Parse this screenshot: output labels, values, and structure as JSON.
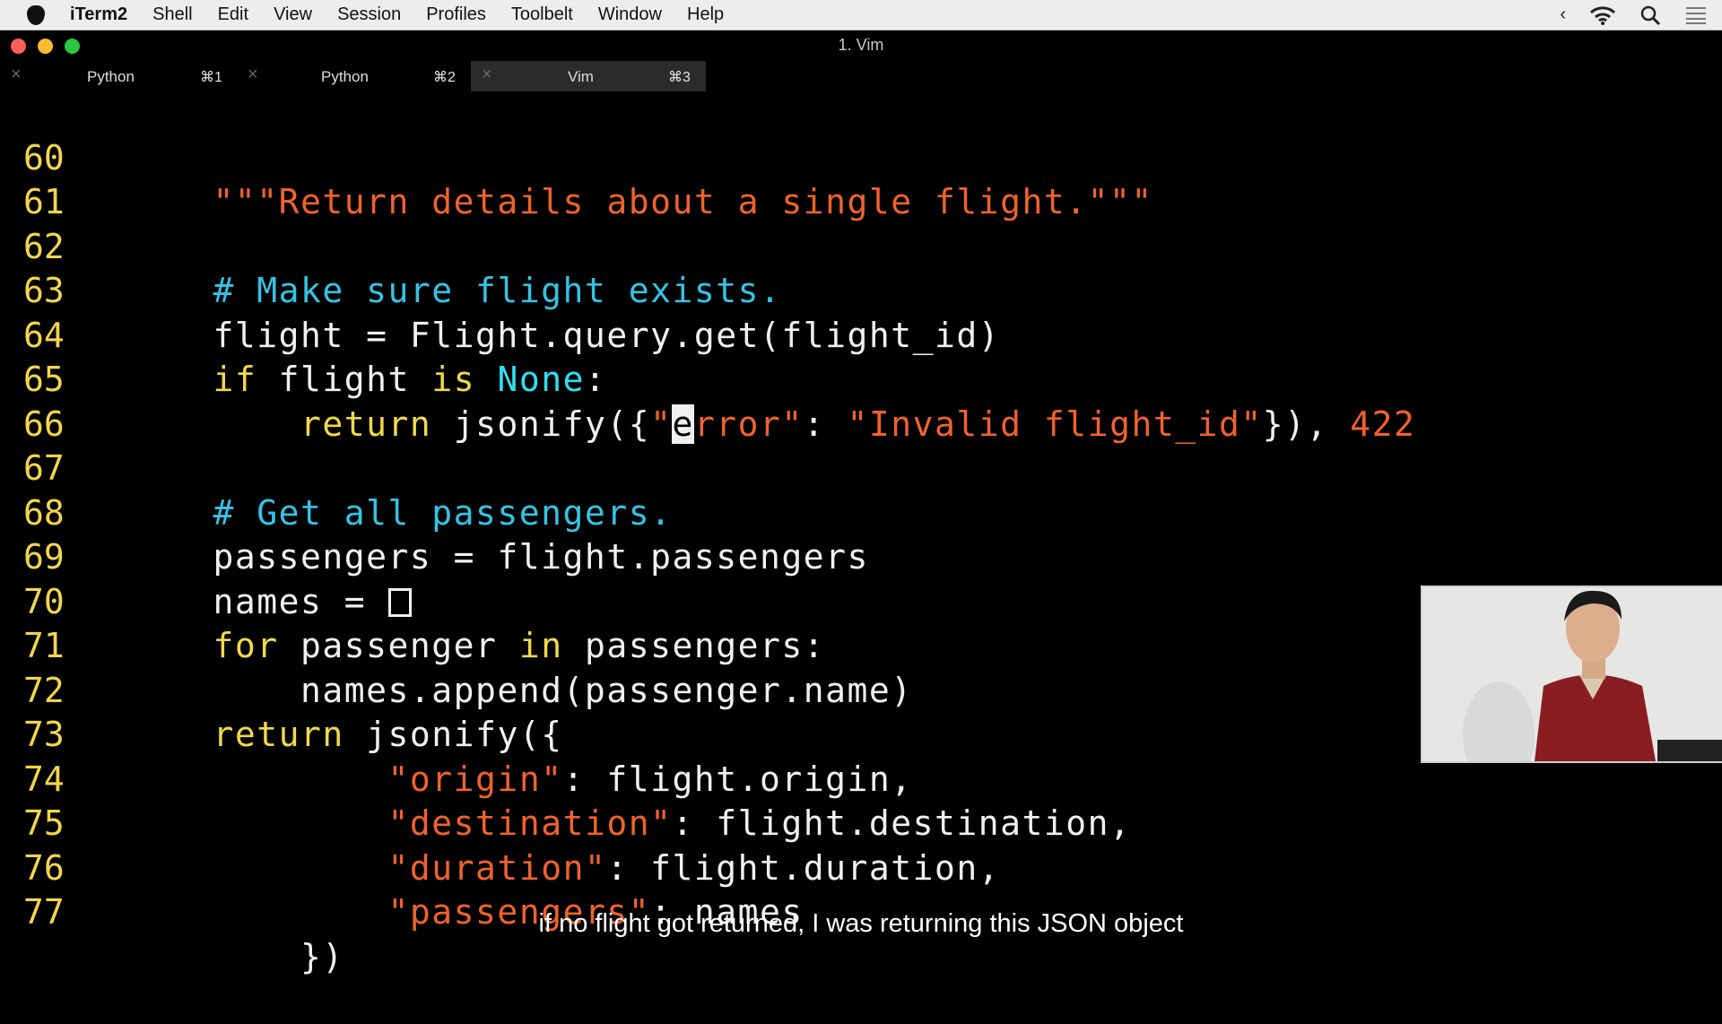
{
  "menubar": {
    "app_name": "iTerm2",
    "items": [
      "Shell",
      "Edit",
      "View",
      "Session",
      "Profiles",
      "Toolbelt",
      "Window",
      "Help"
    ],
    "status_icons": [
      "chevron-left-icon",
      "wifi-icon",
      "search-icon",
      "list-icon"
    ]
  },
  "window": {
    "title": "1. Vim",
    "traffic_lights": {
      "close": "#ff5f57",
      "minimize": "#febc2e",
      "zoom": "#28c840"
    }
  },
  "tabs": [
    {
      "label": "Python",
      "shortcut": "⌘1",
      "active": false
    },
    {
      "label": "Python",
      "shortcut": "⌘2",
      "active": false
    },
    {
      "label": "Vim",
      "shortcut": "⌘3",
      "active": true
    }
  ],
  "editor": {
    "lines": [
      {
        "num": "60",
        "text": "    \"\"\"Return details about a single flight.\"\"\""
      },
      {
        "num": "61",
        "text": ""
      },
      {
        "num": "62",
        "text": "    # Make sure flight exists."
      },
      {
        "num": "63",
        "text": "    flight = Flight.query.get(flight_id)"
      },
      {
        "num": "64",
        "text": "    if flight is None:"
      },
      {
        "num": "65",
        "text": "        return jsonify({\"error\": \"Invalid flight_id\"}), 422"
      },
      {
        "num": "66",
        "text": ""
      },
      {
        "num": "67",
        "text": "    # Get all passengers."
      },
      {
        "num": "68",
        "text": "    passengers = flight.passengers"
      },
      {
        "num": "69",
        "text": "    names = []"
      },
      {
        "num": "70",
        "text": "    for passenger in passengers:"
      },
      {
        "num": "71",
        "text": "        names.append(passenger.name)"
      },
      {
        "num": "72",
        "text": "    return jsonify({"
      },
      {
        "num": "73",
        "text": "            \"origin\": flight.origin,"
      },
      {
        "num": "74",
        "text": "            \"destination\": flight.destination,"
      },
      {
        "num": "75",
        "text": "            \"duration\": flight.duration,"
      },
      {
        "num": "76",
        "text": "            \"passengers\": names"
      },
      {
        "num": "77",
        "text": "        })"
      }
    ],
    "colors": {
      "line_number": "#f2d64b",
      "keyword": "#f0d94a",
      "string": "#f0622b",
      "comment": "#35c3e6",
      "text": "#f0f0f0"
    }
  },
  "caption": "if no flight got returned, I was returning this JSON object"
}
